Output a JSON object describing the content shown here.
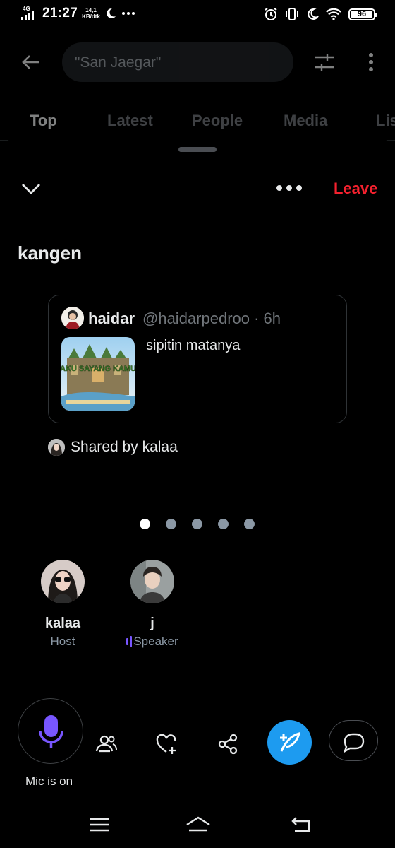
{
  "status_bar": {
    "network": "4G",
    "time": "21:27",
    "speed_value": "14,1",
    "speed_unit": "KB/dtk",
    "battery": "96"
  },
  "search": {
    "query": "\"San Jaegar\""
  },
  "tabs": [
    {
      "label": "Top",
      "active": true
    },
    {
      "label": "Latest",
      "active": false
    },
    {
      "label": "People",
      "active": false
    },
    {
      "label": "Media",
      "active": false
    },
    {
      "label": "Lists",
      "active": false
    }
  ],
  "space": {
    "leave_label": "Leave",
    "title": "kangen",
    "shared_post": {
      "author_name": "haidar",
      "author_handle": "@haidarpedroo · 6h",
      "text": "sipitin matanya",
      "media_caption": "AKU SAYANG KAMU"
    },
    "shared_by": "Shared by kalaa",
    "pager": {
      "count": 5,
      "active_index": 0
    },
    "participants": [
      {
        "name": "kalaa",
        "role": "Host"
      },
      {
        "name": "j",
        "role": "Speaker"
      }
    ],
    "mic_label": "Mic is on"
  },
  "colors": {
    "accent": "#1d9bf0",
    "leave": "#f4212e",
    "mic": "#7856ff"
  }
}
